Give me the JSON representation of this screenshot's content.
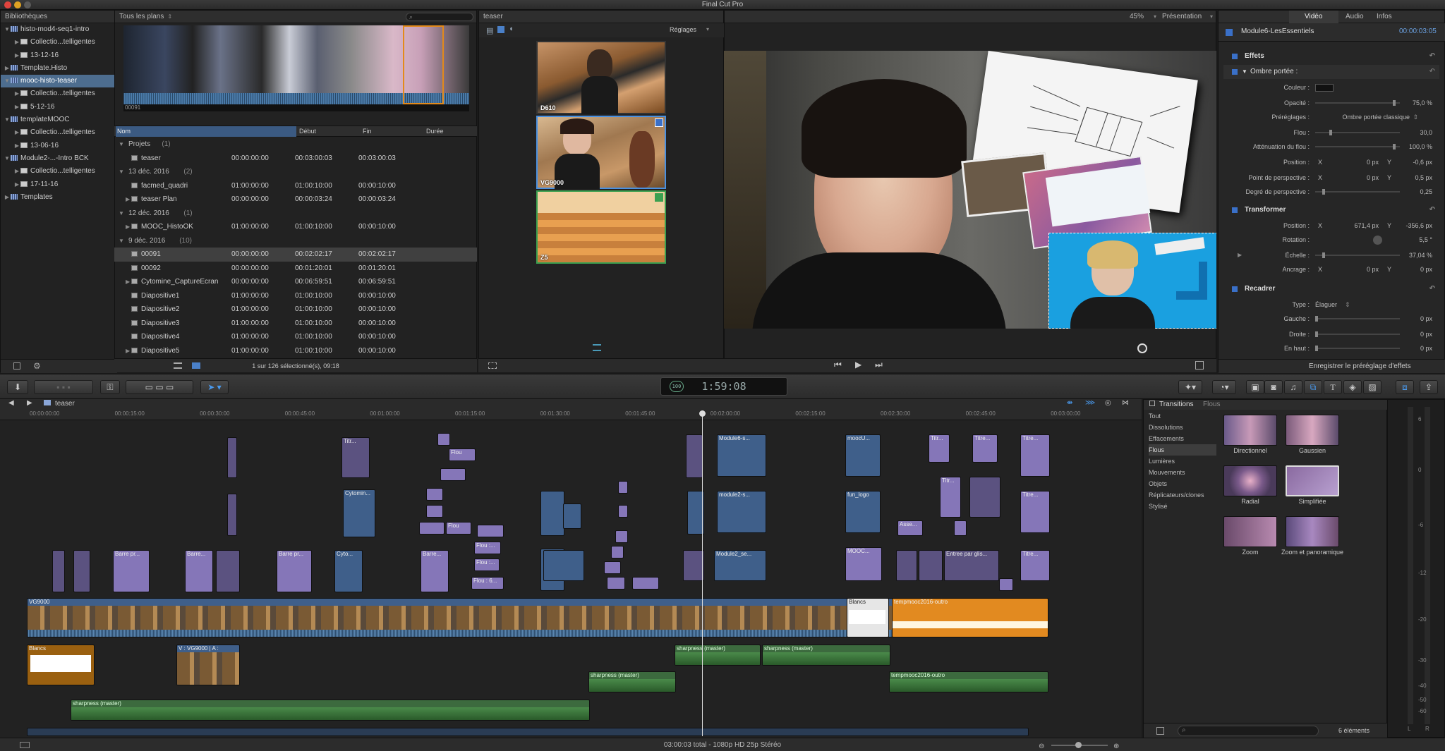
{
  "app": {
    "title": "Final Cut Pro"
  },
  "library": {
    "header": "Bibliothèques",
    "items": [
      {
        "label": "histo-mod4-seq1-intro",
        "kind": "lib",
        "open": true
      },
      {
        "label": "Collectio...telligentes",
        "kind": "coll"
      },
      {
        "label": "13-12-16",
        "kind": "event"
      },
      {
        "label": "Template.Histo",
        "kind": "lib"
      },
      {
        "label": "mooc-histo-teaser",
        "kind": "lib",
        "open": true,
        "selected": true
      },
      {
        "label": "Collectio...telligentes",
        "kind": "coll"
      },
      {
        "label": "5-12-16",
        "kind": "event"
      },
      {
        "label": "templateMOOC",
        "kind": "lib",
        "open": true
      },
      {
        "label": "Collectio...telligentes",
        "kind": "coll"
      },
      {
        "label": "13-06-16",
        "kind": "event"
      },
      {
        "label": "Module2-...-Intro BCK",
        "kind": "lib",
        "open": true
      },
      {
        "label": "Collectio...telligentes",
        "kind": "coll"
      },
      {
        "label": "17-11-16",
        "kind": "event"
      },
      {
        "label": "Templates",
        "kind": "lib"
      }
    ]
  },
  "browser": {
    "filter": "Tous les plans",
    "filmstrip_label": "00091",
    "columns": [
      "Nom",
      "Début",
      "Fin",
      "Durée"
    ],
    "rows": [
      {
        "name": "Projets",
        "count": "(1)",
        "group": true
      },
      {
        "name": "teaser",
        "start": "00:00:00:00",
        "end": "00:03:00:03",
        "dur": "00:03:00:03"
      },
      {
        "name": "13 déc. 2016",
        "count": "(2)",
        "group": true
      },
      {
        "name": "facmed_quadri",
        "start": "01:00:00:00",
        "end": "01:00:10:00",
        "dur": "00:00:10:00"
      },
      {
        "name": "teaser Plan",
        "start": "00:00:00:00",
        "end": "00:00:03:24",
        "dur": "00:00:03:24"
      },
      {
        "name": "12 déc. 2016",
        "count": "(1)",
        "group": true
      },
      {
        "name": "MOOC_HistoOK",
        "start": "01:00:00:00",
        "end": "01:00:10:00",
        "dur": "00:00:10:00"
      },
      {
        "name": "9 déc. 2016",
        "count": "(10)",
        "group": true
      },
      {
        "name": "00091",
        "start": "00:00:00:00",
        "end": "00:02:02:17",
        "dur": "00:02:02:17",
        "selected": true
      },
      {
        "name": "00092",
        "start": "00:00:00:00",
        "end": "00:01:20:01",
        "dur": "00:01:20:01"
      },
      {
        "name": "Cytomine_CaptureEcran",
        "start": "00:00:00:00",
        "end": "00:06:59:51",
        "dur": "00:06:59:51"
      },
      {
        "name": "Diapositive1",
        "start": "01:00:00:00",
        "end": "01:00:10:00",
        "dur": "00:00:10:00"
      },
      {
        "name": "Diapositive2",
        "start": "01:00:00:00",
        "end": "01:00:10:00",
        "dur": "00:00:10:00"
      },
      {
        "name": "Diapositive3",
        "start": "01:00:00:00",
        "end": "01:00:10:00",
        "dur": "00:00:10:00"
      },
      {
        "name": "Diapositive4",
        "start": "01:00:00:00",
        "end": "01:00:10:00",
        "dur": "00:00:10:00"
      },
      {
        "name": "Diapositive5",
        "start": "01:00:00:00",
        "end": "01:00:10:00",
        "dur": "00:00:10:00"
      }
    ],
    "footer": "1 sur 126 sélectionné(s), 09:18"
  },
  "event_viewer": {
    "title": "teaser",
    "settings": "Réglages",
    "thumbs": [
      "D610",
      "VG9000",
      "Z5"
    ]
  },
  "viewer": {
    "zoom": "45%",
    "mode": "Présentation"
  },
  "inspector": {
    "tabs": [
      "Vidéo",
      "Audio",
      "Infos"
    ],
    "clip_name": "Module6-LesEssentiels",
    "clip_time": "00:00:03:05",
    "sections": {
      "effects": "Effets",
      "drop_shadow": "Ombre portée :",
      "transform": "Transformer",
      "crop": "Recadrer"
    },
    "shadow": [
      {
        "label": "Couleur :",
        "value": ""
      },
      {
        "label": "Opacité :",
        "value": "75,0  %"
      },
      {
        "label": "Préréglages :",
        "value": "Ombre portée classique"
      },
      {
        "label": "Flou :",
        "value": "30,0"
      },
      {
        "label": "Atténuation du flou :",
        "value": "100,0  %"
      },
      {
        "label": "Position :",
        "x": "0  px",
        "y": "-0,6  px"
      },
      {
        "label": "Point de perspective :",
        "x": "0  px",
        "y": "0,5  px"
      },
      {
        "label": "Degré de perspective :",
        "value": "0,25"
      }
    ],
    "transform": [
      {
        "label": "Position :",
        "x": "671,4  px",
        "y": "-356,6  px"
      },
      {
        "label": "Rotation :",
        "value": "5,5  °"
      },
      {
        "label": "Échelle :",
        "value": "37,04  %"
      },
      {
        "label": "Ancrage :",
        "x": "0  px",
        "y": "0  px"
      }
    ],
    "crop": [
      {
        "label": "Type :",
        "value": "Élaguer"
      },
      {
        "label": "Gauche :",
        "value": "0  px"
      },
      {
        "label": "Droite :",
        "value": "0  px"
      },
      {
        "label": "En haut :",
        "value": "0  px"
      }
    ],
    "save_preset": "Enregistrer le préréglage d'effets"
  },
  "toolbar": {
    "timecode": "1:59:08",
    "tc_prefix": "100"
  },
  "timeline": {
    "project": "teaser",
    "ruler": [
      "00:00:00:00",
      "00:00:15:00",
      "00:00:30:00",
      "00:00:45:00",
      "00:01:00:00",
      "00:01:15:00",
      "00:01:30:00",
      "00:01:45:00",
      "00:02:00:00",
      "00:02:15:00",
      "00:02:30:00",
      "00:02:45:00",
      "00:03:00:00"
    ],
    "labels": {
      "vg9000": "VG9000",
      "vg9000a": "V : VG9000 | A :",
      "blancs": "Blancs",
      "blancs2": "Blancs",
      "outro": "tempmooc2016-outro",
      "outro2": "tempmooc2016-outro",
      "sharp1": "sharpness (master)",
      "sharp2": "sharpness (master)",
      "sharp3": "sharpness (master)",
      "sharp4": "sharpness (master)",
      "barre1": "Barre pr...",
      "barre2": "Barre...",
      "barre3": "Barre pr...",
      "barre4": "Barre...",
      "cyto1": "Cytomin...",
      "cyto2": "Cyto...",
      "flou1": "Flou",
      "flou2": "Flou",
      "flou3": "Flou :...",
      "flou4": "Flou : 6...",
      "flou5": "Flou :...",
      "mod6": "Module6-s...",
      "mod2": "module2-s...",
      "mod2b": "Module2_se...",
      "mooc": "moocU...",
      "mooc2": "MOOC...",
      "funlogo": "fun_logo",
      "titre1": "Titr...",
      "titre2": "Titre...",
      "titre3": "Titre...",
      "entree": "Entree par glis...",
      "asse": "Asse..."
    }
  },
  "transitions": {
    "title": "Transitions",
    "subtitle": "Flous",
    "categories": [
      "Tout",
      "Dissolutions",
      "Effacements",
      "Flous",
      "Lumières",
      "Mouvements",
      "Objets",
      "Réplicateurs/clones",
      "Stylisé"
    ],
    "selected_category": "Flous",
    "items": [
      "Directionnel",
      "Gaussien",
      "Radial",
      "Simplifiée",
      "Zoom",
      "Zoom et panoramique"
    ],
    "count": "6 éléments"
  },
  "meters": [
    "6",
    "0",
    "-6",
    "-12",
    "-20",
    "-30",
    "-40",
    "-50",
    "-60"
  ],
  "meter_lr": [
    "L",
    "R"
  ],
  "status": "03:00:03 total - 1080p HD 25p Stéréo"
}
